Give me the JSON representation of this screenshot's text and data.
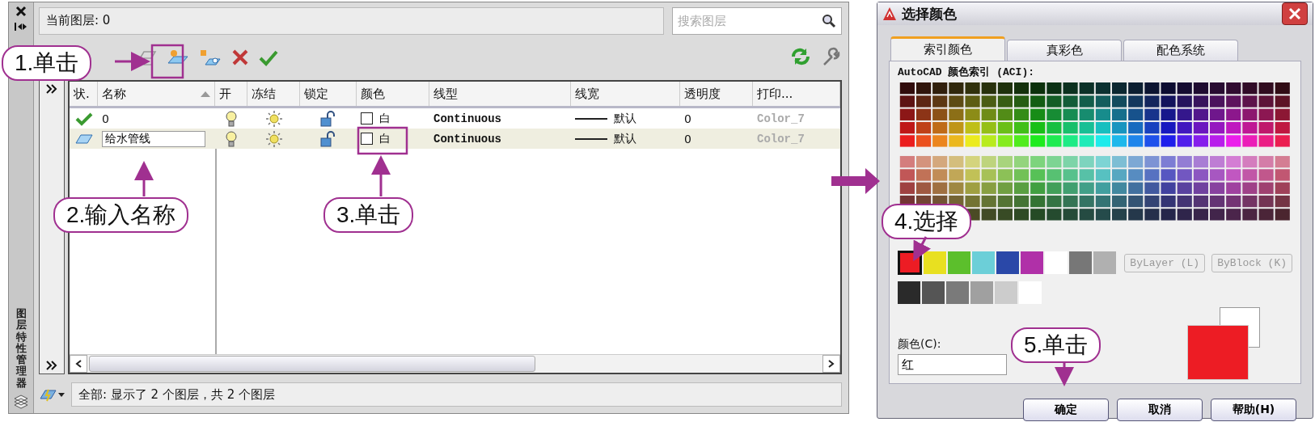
{
  "layer_panel": {
    "side_title": "图层特性管理器",
    "current_layer": "当前图层: 0",
    "search": {
      "placeholder": "搜索图层"
    },
    "columns": [
      "状.",
      "名称",
      "开",
      "冻结",
      "锁定",
      "颜色",
      "线型",
      "线宽",
      "透明度",
      "打印..."
    ],
    "rows": [
      {
        "kind": "current",
        "name": "0",
        "editing": false,
        "selected": false,
        "on": true,
        "frozen": false,
        "locked": false,
        "color": "#ffffff",
        "color_name": "白",
        "linetype": "Continuous",
        "lineweight": "默认",
        "transparency": "0",
        "plot_style": "Color_7"
      },
      {
        "kind": "layer",
        "name": "给水管线",
        "editing": true,
        "selected": true,
        "on": true,
        "frozen": false,
        "locked": false,
        "color": "#ffffff",
        "color_name": "白",
        "linetype": "Continuous",
        "lineweight": "默认",
        "transparency": "0",
        "plot_style": "Color_7"
      }
    ],
    "status_text": "全部: 显示了 2 个图层，共 2 个图层"
  },
  "color_dialog": {
    "title": "选择颜色",
    "tabs": [
      {
        "label": "索引颜色",
        "selected": true
      },
      {
        "label": "真彩色",
        "selected": false
      },
      {
        "label": "配色系统",
        "selected": false
      }
    ],
    "aci_label": "AutoCAD 颜色索引 (ACI):",
    "standard_colors": [
      {
        "color": "#ed1c24",
        "selected": true
      },
      {
        "color": "#e8e020",
        "selected": false
      },
      {
        "color": "#5cbf2c",
        "selected": false
      },
      {
        "color": "#6ccfd8",
        "selected": false
      },
      {
        "color": "#2a48a8",
        "selected": false
      },
      {
        "color": "#b030a8",
        "selected": false
      },
      {
        "color": "#ffffff",
        "selected": false
      },
      {
        "color": "#777777",
        "selected": false
      },
      {
        "color": "#b0b0b0",
        "selected": false
      }
    ],
    "gray_colors": [
      {
        "color": "#2a2a2a",
        "selected": false
      },
      {
        "color": "#555555",
        "selected": false
      },
      {
        "color": "#7a7a7a",
        "selected": false
      },
      {
        "color": "#a0a0a0",
        "selected": false
      },
      {
        "color": "#cccccc",
        "selected": false
      },
      {
        "color": "#ffffff",
        "selected": false
      }
    ],
    "side_buttons": [
      {
        "label": "ByLayer (L)",
        "disabled": true
      },
      {
        "label": "ByBlock (K)",
        "disabled": true
      }
    ],
    "color_label": "颜色(C):",
    "color_value": "红",
    "preview": [
      {
        "kind": "old",
        "color": "#ffffff"
      },
      {
        "kind": "new",
        "color": "#ed1c24"
      }
    ],
    "buttons": [
      "确定",
      "取消",
      "帮助(H)"
    ]
  },
  "annotations": [
    {
      "text": "1.单击"
    },
    {
      "text": "2.输入名称"
    },
    {
      "text": "3.单击"
    },
    {
      "text": "4.选择"
    },
    {
      "text": "5.单击"
    }
  ]
}
